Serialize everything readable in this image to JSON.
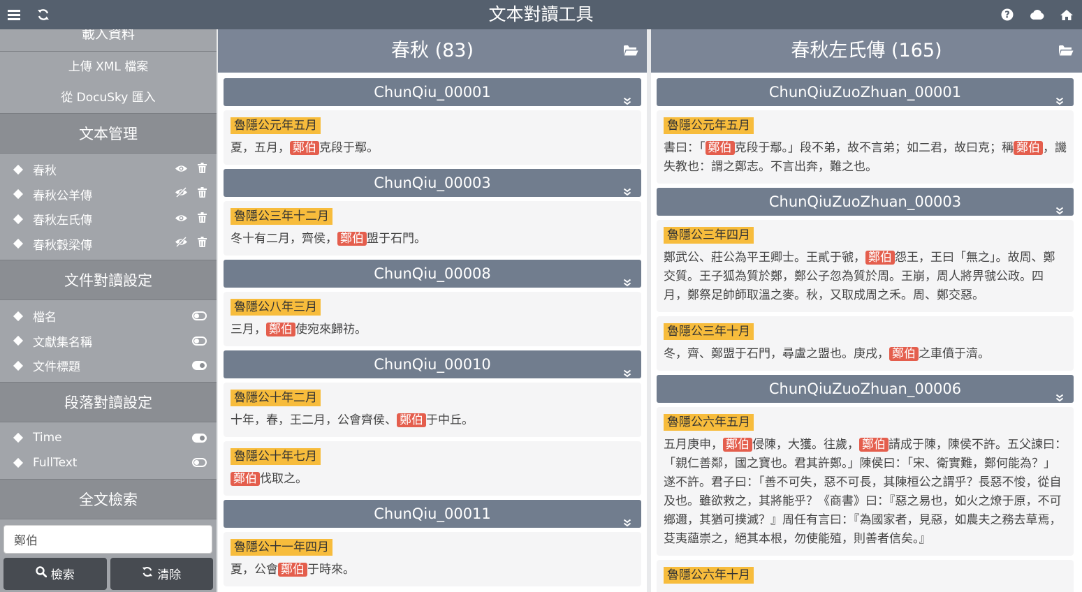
{
  "app": {
    "title": "文本對讀工具"
  },
  "topbar": {
    "menu_icon": "bars-icon",
    "refresh_icon": "refresh-icon",
    "help_icon": "question-circle-icon",
    "cloud_icon": "cloud-icon",
    "home_icon": "home-icon"
  },
  "sidebar": {
    "load_cut_label": "載入資料",
    "upload_label": "上傳 XML 檔案",
    "import_label": "從 DocuSky 匯入",
    "text_mgmt": {
      "title": "文本管理",
      "items": [
        {
          "label": "春秋",
          "visible": true
        },
        {
          "label": "春秋公羊傳",
          "visible": false
        },
        {
          "label": "春秋左氏傳",
          "visible": true
        },
        {
          "label": "春秋穀梁傳",
          "visible": false
        }
      ]
    },
    "doc_settings": {
      "title": "文件對讀設定",
      "items": [
        {
          "label": "檔名",
          "on": false
        },
        {
          "label": "文獻集名稱",
          "on": false
        },
        {
          "label": "文件標題",
          "on": true
        }
      ]
    },
    "para_settings": {
      "title": "段落對讀設定",
      "items": [
        {
          "label": "Time",
          "on": true
        },
        {
          "label": "FullText",
          "on": false
        }
      ]
    },
    "search": {
      "title": "全文檢索",
      "value": "鄭伯",
      "search_label": "檢索",
      "clear_label": "清除"
    }
  },
  "left": {
    "title": "春秋 (83)",
    "docs": [
      {
        "name": "ChunQiu_00001",
        "paras": [
          {
            "time": "魯隱公元年五月",
            "text": "夏，五月，{鄭伯}克段于鄢。"
          }
        ]
      },
      {
        "name": "ChunQiu_00003",
        "paras": [
          {
            "time": "魯隱公三年十二月",
            "text": "冬十有二月，齊侯，{鄭伯}盟于石門。"
          }
        ]
      },
      {
        "name": "ChunQiu_00008",
        "paras": [
          {
            "time": "魯隱公八年三月",
            "text": "三月，{鄭伯}使宛來歸祊。"
          }
        ]
      },
      {
        "name": "ChunQiu_00010",
        "paras": [
          {
            "time": "魯隱公十年二月",
            "text": "十年，春，王二月，公會齊侯、{鄭伯}于中丘。"
          },
          {
            "time": "魯隱公十年七月",
            "text": "{鄭伯}伐取之。"
          }
        ]
      },
      {
        "name": "ChunQiu_00011",
        "paras": [
          {
            "time": "魯隱公十一年四月",
            "text": "夏，公會{鄭伯}于時來。"
          }
        ]
      }
    ]
  },
  "right": {
    "title": "春秋左氏傳 (165)",
    "docs": [
      {
        "name": "ChunQiuZuoZhuan_00001",
        "paras": [
          {
            "time": "魯隱公元年五月",
            "text": "書曰：「{鄭伯}克段于鄢。」段不弟，故不言弟；如二君，故曰克；稱{鄭伯}，譏失教也：謂之鄭志。不言出奔，難之也。"
          }
        ]
      },
      {
        "name": "ChunQiuZuoZhuan_00003",
        "paras": [
          {
            "time": "魯隱公三年四月",
            "text": "鄭武公、莊公為平王卿士。王貳于虢，{鄭伯}怨王，王曰「無之」。故周、鄭交質。王子狐為質於鄭，鄭公子忽為質於周。王崩，周人將畀虢公政。四月，鄭祭足帥師取溫之麥。秋，又取成周之禾。周、鄭交惡。"
          },
          {
            "time": "魯隱公三年十月",
            "text": "冬，齊、鄭盟于石門，尋盧之盟也。庚戌，{鄭伯}之車僨于濟。"
          }
        ]
      },
      {
        "name": "ChunQiuZuoZhuan_00006",
        "paras": [
          {
            "time": "魯隱公六年五月",
            "text": "五月庚申，{鄭伯}侵陳，大獲。往歲，{鄭伯}請成于陳，陳侯不許。五父諫曰：「親仁善鄰，國之寶也。君其許鄭。」陳侯曰：「宋、衛實難，鄭何能為？」遂不許。君子曰：「善不可失，惡不可長，其陳桓公之謂乎？長惡不悛，從自及也。雖欲救之，其將能乎？《商書》曰：『惡之易也，如火之燎于原，不可鄉邇，其猶可撲滅？』周任有言曰：『為國家者，見惡，如農夫之務去草焉，芟夷蘊崇之，絕其本根，勿使能殖，則善者信矣。』"
          },
          {
            "time": "魯隱公六年十月",
            "text": ""
          }
        ]
      }
    ]
  }
}
